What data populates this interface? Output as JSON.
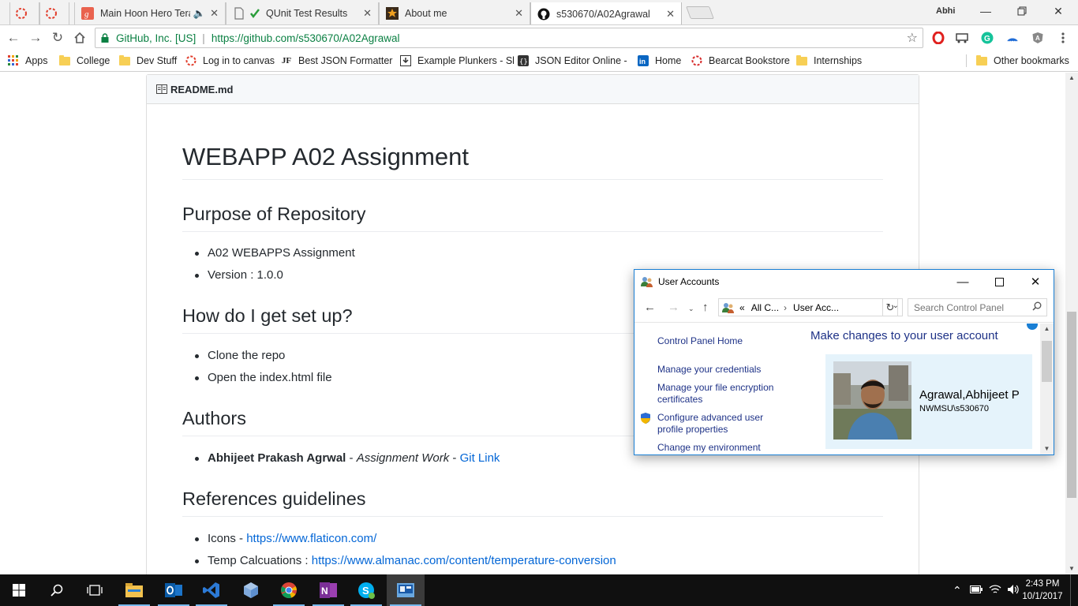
{
  "tabs": [
    {
      "title": ""
    },
    {
      "title": ""
    },
    {
      "title": "Main Hoon Hero Tera"
    },
    {
      "title": "QUnit Test Results"
    },
    {
      "title": "About me"
    },
    {
      "title": "s530670/A02Agrawal"
    }
  ],
  "profile_name": "Abhi",
  "omnibox": {
    "origin": "GitHub, Inc. [US]",
    "url": "https://github.com/s530670/A02Agrawal"
  },
  "bookmarks": [
    {
      "label": "Apps",
      "icon": "apps-grid-icon"
    },
    {
      "label": "College",
      "icon": "folder-icon"
    },
    {
      "label": "Dev Stuff",
      "icon": "folder-icon"
    },
    {
      "label": "Log in to canvas",
      "icon": "canvas-icon"
    },
    {
      "label": "Best JSON Formatter",
      "icon": "jf-icon"
    },
    {
      "label": "Example Plunkers - Sl",
      "icon": "plunker-icon"
    },
    {
      "label": "JSON Editor Online -",
      "icon": "json-editor-icon"
    },
    {
      "label": "Home",
      "icon": "linkedin-icon"
    },
    {
      "label": "Bearcat Bookstore",
      "icon": "bookstore-icon"
    },
    {
      "label": "Internships",
      "icon": "folder-icon"
    },
    {
      "label": "Other bookmarks",
      "icon": "folder-icon"
    }
  ],
  "readme": {
    "filename": "README.md",
    "title": "WEBAPP A02 Assignment",
    "purpose_heading": "Purpose of Repository",
    "purpose_items": [
      "A02 WEBAPPS Assignment",
      "Version : 1.0.0"
    ],
    "setup_heading": "How do I get set up?",
    "setup_items": [
      "Clone the repo",
      "Open the index.html file"
    ],
    "authors_heading": "Authors",
    "author_name": "Abhijeet Prakash Agrwal",
    "author_sep1": " - ",
    "author_role": "Assignment Work",
    "author_sep2": " - ",
    "author_link": "Git Link",
    "refs_heading": "References guidelines",
    "ref1_label": "Icons - ",
    "ref1_link": "https://www.flaticon.com/",
    "ref2_label": "Temp Calcuations : ",
    "ref2_link": "https://www.almanac.com/content/temperature-conversion"
  },
  "user_accounts": {
    "title": "User Accounts",
    "crumb_prefix": "«",
    "crumb_1": "All C...",
    "crumb_2": "User Acc...",
    "search_placeholder": "Search Control Panel",
    "links": [
      "Control Panel Home",
      "Manage your credentials",
      "Manage your file encryption certificates",
      "Configure advanced user profile properties",
      "Change my environment"
    ],
    "heading": "Make changes to your user account",
    "user_name": "Agrawal,Abhijeet P",
    "user_domain": "NWMSU\\s530670"
  },
  "taskbar": {
    "time": "2:43 PM",
    "date": "10/1/2017",
    "apps": [
      "start-icon",
      "search-icon",
      "task-view-icon",
      "file-explorer-icon",
      "outlook-icon",
      "visual-studio-icon",
      "virtualbox-icon",
      "chrome-icon",
      "onenote-icon",
      "skype-icon",
      "control-panel-icon"
    ]
  },
  "colors": {
    "accent_link": "#0366d6",
    "secure_green": "#0b8043",
    "control_panel_link": "#1e3287",
    "window_border": "#1a7fd4"
  }
}
